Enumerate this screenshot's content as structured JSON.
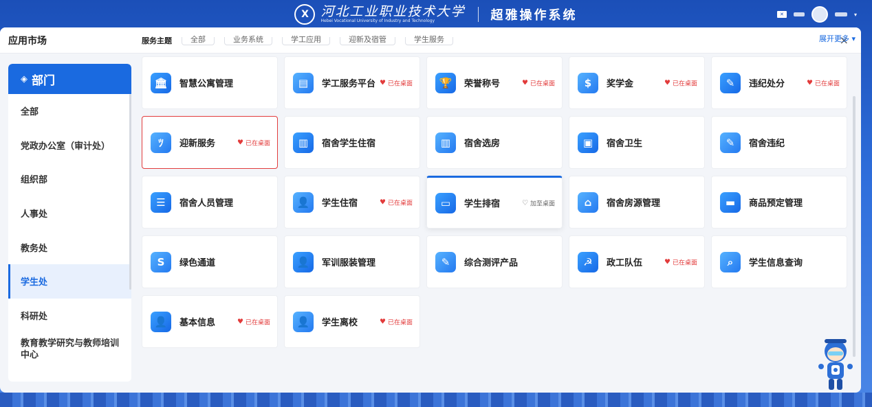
{
  "header": {
    "logo_text": "X",
    "school_cn": "河北工业职业技术大学",
    "school_en": "Hebei Vocational University of Industry and Technology",
    "system_name": "超雅操作系统"
  },
  "window": {
    "title": "应用市场",
    "close_icon": "×"
  },
  "sidebar": {
    "title": "部门",
    "items": [
      {
        "label": "全部"
      },
      {
        "label": "党政办公室（审计处）"
      },
      {
        "label": "组织部"
      },
      {
        "label": "人事处"
      },
      {
        "label": "教务处"
      },
      {
        "label": "学生处",
        "active": true
      },
      {
        "label": "科研处"
      },
      {
        "label": "教育教学研究与教师培训中心"
      }
    ]
  },
  "filters": {
    "label": "服务主题",
    "chips": [
      "全部",
      "业务系统",
      "学工应用",
      "迎新及宿管",
      "学生服务"
    ],
    "expand": "展开更多 ▾"
  },
  "badges": {
    "on_desktop": "已在桌面",
    "add_desktop": "加至桌面"
  },
  "apps": [
    {
      "name": "智慧公寓管理",
      "icon": "bank-icon",
      "glyph": "🏛",
      "badge": ""
    },
    {
      "name": "学工服务平台",
      "icon": "document-icon",
      "glyph": "▤",
      "badge": "on"
    },
    {
      "name": "荣誉称号",
      "icon": "trophy-icon",
      "glyph": "🏆",
      "badge": "on"
    },
    {
      "name": "奖学金",
      "icon": "money-bag-icon",
      "glyph": "$",
      "badge": "on"
    },
    {
      "name": "违纪处分",
      "icon": "edit-document-icon",
      "glyph": "✎",
      "badge": "on"
    },
    {
      "name": "迎新服务",
      "icon": "welcome-icon",
      "glyph": "ﾂ",
      "badge": "on",
      "selected": true
    },
    {
      "name": "宿舍学生住宿",
      "icon": "building-icon",
      "glyph": "▥",
      "badge": ""
    },
    {
      "name": "宿舍选房",
      "icon": "building-icon",
      "glyph": "▥",
      "badge": ""
    },
    {
      "name": "宿舍卫生",
      "icon": "picture-icon",
      "glyph": "▣",
      "badge": ""
    },
    {
      "name": "宿舍违纪",
      "icon": "edit-document-icon",
      "glyph": "✎",
      "badge": ""
    },
    {
      "name": "宿舍人员管理",
      "icon": "list-icon",
      "glyph": "☰",
      "badge": ""
    },
    {
      "name": "学生住宿",
      "icon": "person-icon",
      "glyph": "👤",
      "badge": "on"
    },
    {
      "name": "学生排宿",
      "icon": "id-card-icon",
      "glyph": "▭",
      "badge": "add",
      "hover": true
    },
    {
      "name": "宿舍房源管理",
      "icon": "home-icon",
      "glyph": "⌂",
      "badge": ""
    },
    {
      "name": "商品预定管理",
      "icon": "monitor-icon",
      "glyph": "▬",
      "badge": ""
    },
    {
      "name": "绿色通道",
      "icon": "swap-icon",
      "glyph": "S",
      "badge": ""
    },
    {
      "name": "军训服装管理",
      "icon": "person-icon",
      "glyph": "👤",
      "badge": ""
    },
    {
      "name": "综合测评产品",
      "icon": "edit-document-icon",
      "glyph": "✎",
      "badge": ""
    },
    {
      "name": "政工队伍",
      "icon": "party-icon",
      "glyph": "☭",
      "badge": "on"
    },
    {
      "name": "学生信息查询",
      "icon": "search-icon",
      "glyph": "⌕",
      "badge": ""
    },
    {
      "name": "基本信息",
      "icon": "person-icon",
      "glyph": "👤",
      "badge": "on"
    },
    {
      "name": "学生离校",
      "icon": "person-icon",
      "glyph": "👤",
      "badge": "on"
    }
  ],
  "colors": {
    "accent": "#1a6ae0",
    "danger": "#e23b3b"
  }
}
